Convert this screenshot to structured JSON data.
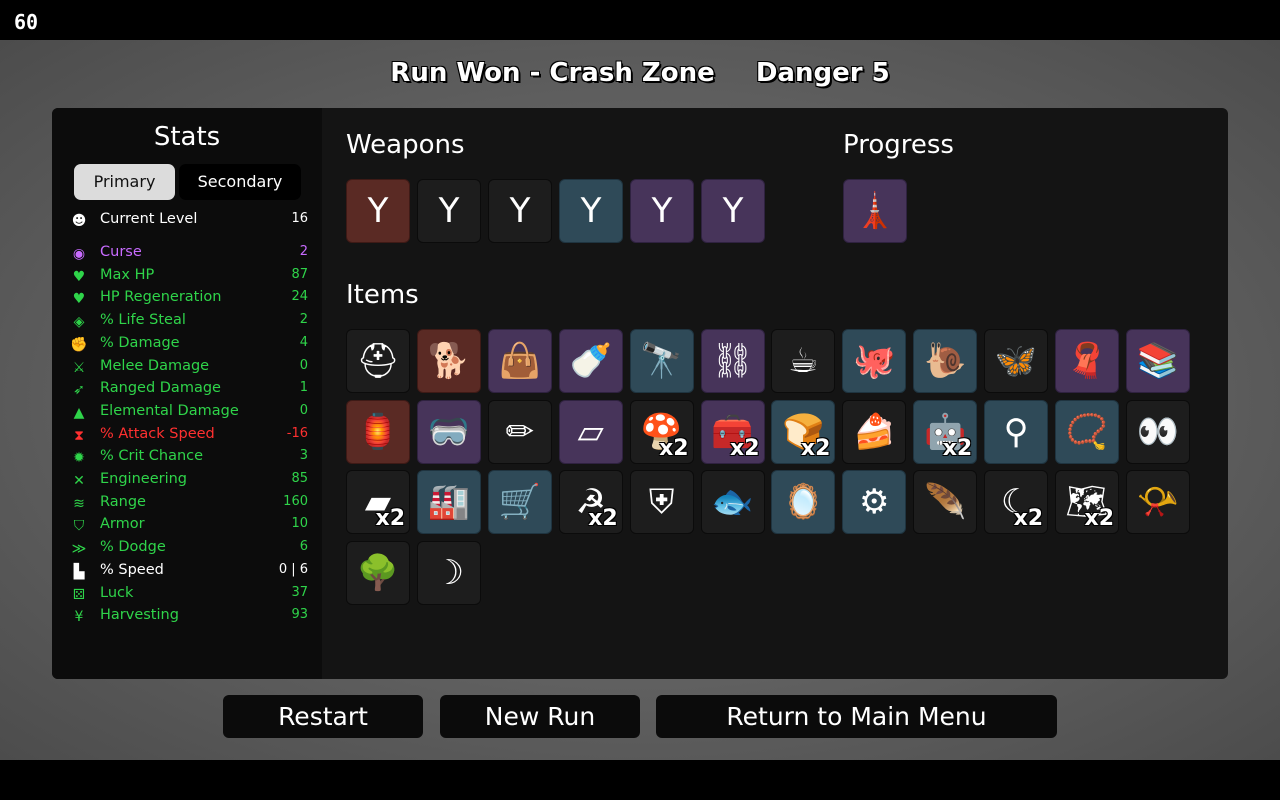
{
  "fps": "60",
  "title": {
    "result": "Run Won - Crash Zone",
    "danger": "Danger 5"
  },
  "stats": {
    "title": "Stats",
    "tabs": {
      "primary": "Primary",
      "secondary": "Secondary"
    },
    "current_level": {
      "label": "Current Level",
      "value": "16",
      "icon": "potato-face-icon",
      "color": "#ffffff"
    },
    "rows": [
      {
        "label": "Curse",
        "value": "2",
        "icon": "eye-icon",
        "color": "#c86bff"
      },
      {
        "label": "Max HP",
        "value": "87",
        "icon": "heart-icon",
        "color": "#2fd44a"
      },
      {
        "label": "HP Regeneration",
        "value": "24",
        "icon": "heart-plus-icon",
        "color": "#2fd44a"
      },
      {
        "label": "% Life Steal",
        "value": "2",
        "icon": "vampire-icon",
        "color": "#2fd44a"
      },
      {
        "label": "% Damage",
        "value": "4",
        "icon": "muscle-icon",
        "color": "#2fd44a"
      },
      {
        "label": "Melee Damage",
        "value": "0",
        "icon": "sword-icon",
        "color": "#2fd44a"
      },
      {
        "label": "Ranged Damage",
        "value": "1",
        "icon": "bow-icon",
        "color": "#2fd44a"
      },
      {
        "label": "Elemental Damage",
        "value": "0",
        "icon": "flame-icon",
        "color": "#2fd44a"
      },
      {
        "label": "% Attack Speed",
        "value": "-16",
        "icon": "hourglass-icon",
        "color": "#ff3030"
      },
      {
        "label": "% Crit Chance",
        "value": "3",
        "icon": "crit-burst-icon",
        "color": "#2fd44a"
      },
      {
        "label": "Engineering",
        "value": "85",
        "icon": "wrench-cross-icon",
        "color": "#2fd44a"
      },
      {
        "label": "Range",
        "value": "160",
        "icon": "range-waves-icon",
        "color": "#2fd44a"
      },
      {
        "label": "Armor",
        "value": "10",
        "icon": "shield-icon",
        "color": "#2fd44a"
      },
      {
        "label": "% Dodge",
        "value": "6",
        "icon": "wing-icon",
        "color": "#2fd44a"
      },
      {
        "label": "% Speed",
        "value": "0 | 6",
        "icon": "boot-icon",
        "color": "#ffffff"
      },
      {
        "label": "Luck",
        "value": "37",
        "icon": "dice-icon",
        "color": "#2fd44a"
      },
      {
        "label": "Harvesting",
        "value": "93",
        "icon": "wheat-icon",
        "color": "#2fd44a"
      }
    ]
  },
  "weapons": {
    "title": "Weapons",
    "slots": [
      {
        "name": "slingshot",
        "tier": 3,
        "glyph": "Y"
      },
      {
        "name": "slingshot",
        "tier": 0,
        "glyph": "Y"
      },
      {
        "name": "slingshot",
        "tier": 0,
        "glyph": "Y"
      },
      {
        "name": "slingshot",
        "tier": 1,
        "glyph": "Y"
      },
      {
        "name": "slingshot",
        "tier": 2,
        "glyph": "Y"
      },
      {
        "name": "slingshot",
        "tier": 2,
        "glyph": "Y"
      }
    ]
  },
  "progress": {
    "title": "Progress",
    "slots": [
      {
        "name": "lighthouse",
        "tier": 2,
        "glyph": "🗼"
      }
    ]
  },
  "items": {
    "title": "Items",
    "slots": [
      {
        "name": "helmet-potato",
        "tier": 0,
        "glyph": "⛑"
      },
      {
        "name": "robot-dog",
        "tier": 3,
        "glyph": "🐕"
      },
      {
        "name": "sack",
        "tier": 2,
        "glyph": "👜"
      },
      {
        "name": "bottle",
        "tier": 2,
        "glyph": "🍼"
      },
      {
        "name": "spyglass",
        "tier": 1,
        "glyph": "🔭"
      },
      {
        "name": "flail",
        "tier": 2,
        "glyph": "⛓"
      },
      {
        "name": "coffee",
        "tier": 0,
        "glyph": "☕"
      },
      {
        "name": "tentacle",
        "tier": 1,
        "glyph": "🐙"
      },
      {
        "name": "snail",
        "tier": 1,
        "glyph": "🐌"
      },
      {
        "name": "butterfly",
        "tier": 0,
        "glyph": "🦋"
      },
      {
        "name": "scarf",
        "tier": 2,
        "glyph": "🧣"
      },
      {
        "name": "books",
        "tier": 2,
        "glyph": "📚"
      },
      {
        "name": "lantern",
        "tier": 3,
        "glyph": "🏮"
      },
      {
        "name": "goggles",
        "tier": 2,
        "glyph": "🥽"
      },
      {
        "name": "pencil",
        "tier": 0,
        "glyph": "✏"
      },
      {
        "name": "eraser",
        "tier": 2,
        "glyph": "▱"
      },
      {
        "name": "mushroom",
        "tier": 0,
        "glyph": "🍄",
        "count": "x2"
      },
      {
        "name": "toolbox",
        "tier": 2,
        "glyph": "🧰",
        "count": "x2"
      },
      {
        "name": "bread",
        "tier": 1,
        "glyph": "🍞",
        "count": "x2"
      },
      {
        "name": "cake",
        "tier": 0,
        "glyph": "🍰"
      },
      {
        "name": "alarm-robot",
        "tier": 1,
        "glyph": "🤖",
        "count": "x2"
      },
      {
        "name": "metal-detector",
        "tier": 1,
        "glyph": "⚲"
      },
      {
        "name": "pendant",
        "tier": 1,
        "glyph": "📿"
      },
      {
        "name": "glowing-eyes",
        "tier": 0,
        "glyph": "👀"
      },
      {
        "name": "metal-bar",
        "tier": 0,
        "glyph": "▰",
        "count": "x2"
      },
      {
        "name": "turret-machine",
        "tier": 1,
        "glyph": "🏭"
      },
      {
        "name": "wheelbarrow",
        "tier": 1,
        "glyph": "🛒"
      },
      {
        "name": "scythe-hand",
        "tier": 0,
        "glyph": "☭",
        "count": "x2"
      },
      {
        "name": "iron-helmet",
        "tier": 0,
        "glyph": "⛨"
      },
      {
        "name": "blue-fish",
        "tier": 0,
        "glyph": "🐟"
      },
      {
        "name": "compact-mirror",
        "tier": 1,
        "glyph": "🪞"
      },
      {
        "name": "chain-ring",
        "tier": 1,
        "glyph": "⚙"
      },
      {
        "name": "feather",
        "tier": 0,
        "glyph": "🪶"
      },
      {
        "name": "claw",
        "tier": 0,
        "glyph": "☾",
        "count": "x2"
      },
      {
        "name": "treasure-map",
        "tier": 0,
        "glyph": "🗺",
        "count": "x2"
      },
      {
        "name": "whistle",
        "tier": 0,
        "glyph": "📯"
      },
      {
        "name": "tree",
        "tier": 0,
        "glyph": "🌳"
      },
      {
        "name": "crescent",
        "tier": 0,
        "glyph": "☽"
      }
    ]
  },
  "buttons": {
    "restart": "Restart",
    "new_run": "New Run",
    "return_menu": "Return to Main Menu"
  }
}
